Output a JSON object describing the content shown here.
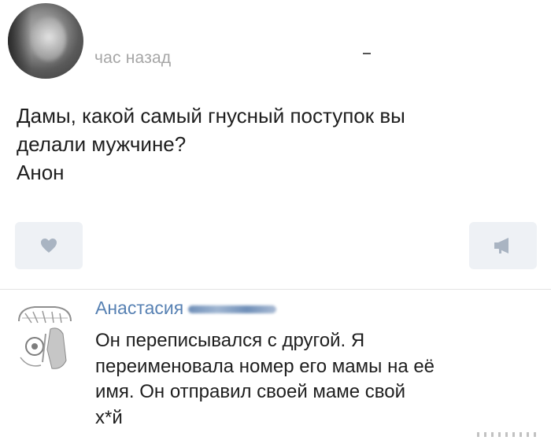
{
  "post": {
    "avatar_icon": "user-avatar-icon",
    "time": "час назад",
    "text_lines": [
      "Дамы, какой самый гнусный поступок вы",
      "делали мужчине?",
      "Анон"
    ],
    "like_icon": "heart-icon",
    "share_icon": "megaphone-icon"
  },
  "comment": {
    "avatar_icon": "commenter-avatar-icon",
    "author_first_name": "Анастасия",
    "text_lines": [
      "Он переписывался с другой. Я",
      "переименовала номер его мамы на её",
      "имя. Он отправил своей маме свой",
      "х*й"
    ]
  },
  "colors": {
    "author_link": "#5781b3",
    "button_bg": "#eef1f5",
    "icon_gray": "#a9b4c2",
    "meta_gray": "#a6a6a6",
    "text": "#1e1e1e"
  }
}
